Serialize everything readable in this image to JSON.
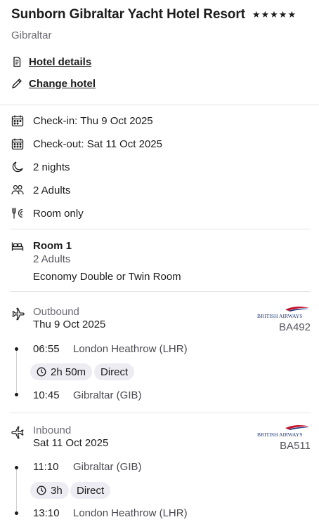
{
  "hotel": {
    "name": "Sunborn Gibraltar Yacht Hotel Resort",
    "stars": "★★★★★",
    "location": "Gibraltar"
  },
  "links": {
    "details": "Hotel details",
    "change": "Change hotel"
  },
  "stay": {
    "checkin": "Check-in: Thu 9 Oct 2025",
    "checkout": "Check-out: Sat 11 Oct 2025",
    "nights": "2 nights",
    "guests": "2 Adults",
    "board": "Room only"
  },
  "room": {
    "title": "Room 1",
    "guests": "2 Adults",
    "type": "Economy Double or Twin Room"
  },
  "outbound": {
    "direction": "Outbound",
    "date": "Thu 9 Oct 2025",
    "flight_number": "BA492",
    "depart_time": "06:55",
    "depart_place": "London Heathrow (LHR)",
    "duration": "2h 50m",
    "stops": "Direct",
    "arrive_time": "10:45",
    "arrive_place": "Gibraltar (GIB)"
  },
  "inbound": {
    "direction": "Inbound",
    "date": "Sat 11 Oct 2025",
    "flight_number": "BA511",
    "depart_time": "11:10",
    "depart_place": "Gibraltar (GIB)",
    "duration": "3h",
    "stops": "Direct",
    "arrive_time": "13:10",
    "arrive_place": "London Heathrow (LHR)"
  },
  "airline_logo_text": "BRITISH AIRWAYS",
  "colors": {
    "ba_blue": "#1b3a7a",
    "ba_red": "#c8102e",
    "pill_bg": "#ececf2"
  }
}
